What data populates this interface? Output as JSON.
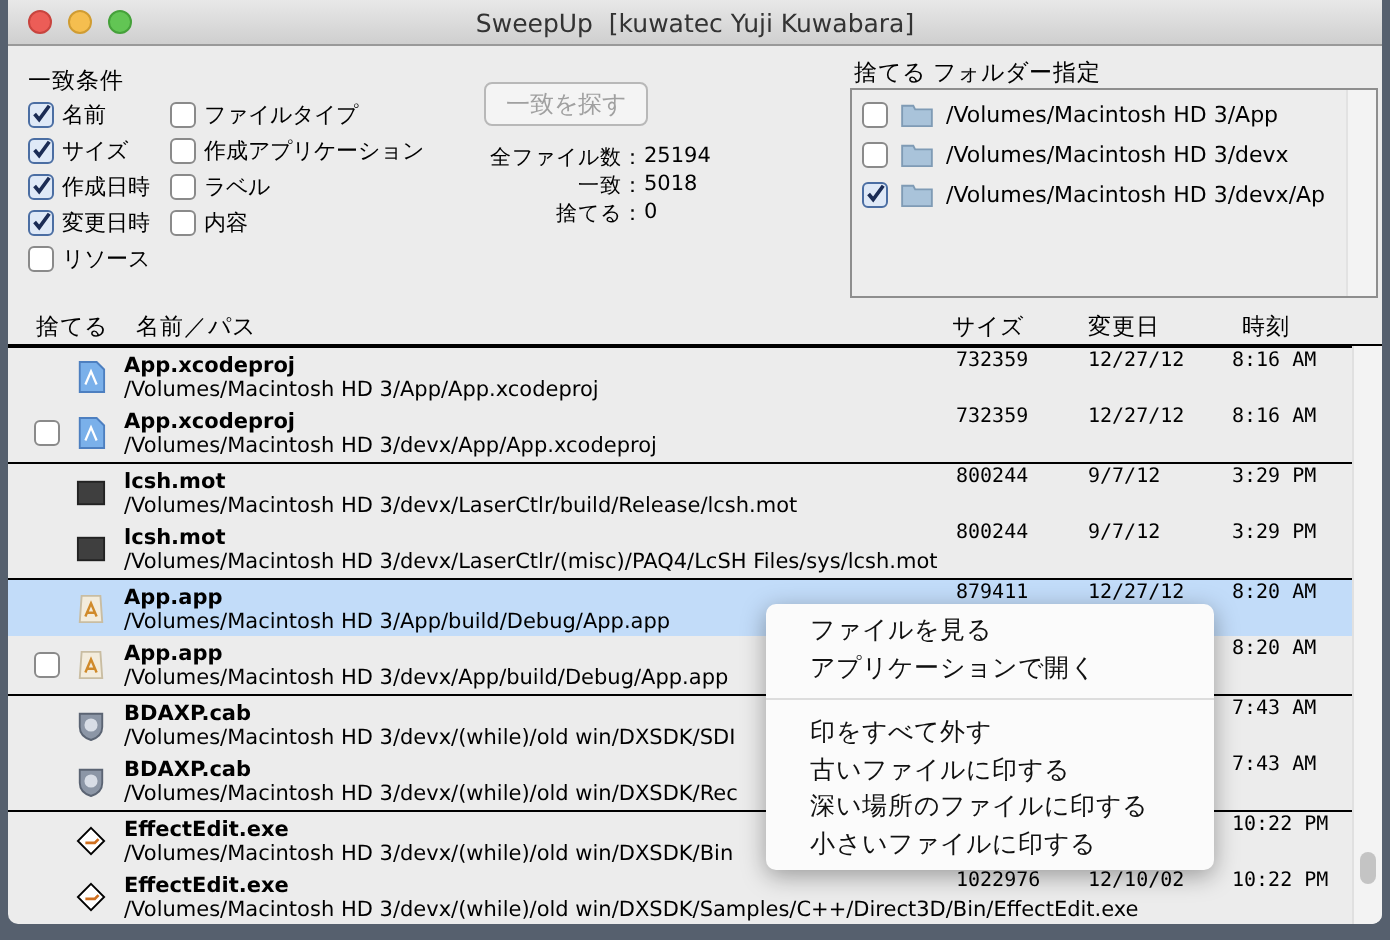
{
  "window": {
    "title": "SweepUp  [kuwatec Yuji Kuwabara]"
  },
  "conditions": {
    "title": "一致条件",
    "items": [
      {
        "label": "名前",
        "checked": true
      },
      {
        "label": "サイズ",
        "checked": true
      },
      {
        "label": "作成日時",
        "checked": true
      },
      {
        "label": "変更日時",
        "checked": true
      },
      {
        "label": "リソース",
        "checked": false
      },
      {
        "label": "ファイルタイプ",
        "checked": false
      },
      {
        "label": "作成アプリケーション",
        "checked": false
      },
      {
        "label": "ラベル",
        "checked": false
      },
      {
        "label": "内容",
        "checked": false
      }
    ]
  },
  "find_button": {
    "label": "一致を探す",
    "disabled": true
  },
  "stats": [
    {
      "label": "全ファイル数：",
      "value": "25194"
    },
    {
      "label": "一致：",
      "value": "5018"
    },
    {
      "label": "捨てる：",
      "value": "0"
    }
  ],
  "folders": {
    "title": "捨てる フォルダー指定",
    "items": [
      {
        "path": "/Volumes/Macintosh HD 3/App",
        "checked": false
      },
      {
        "path": "/Volumes/Macintosh HD 3/devx",
        "checked": false
      },
      {
        "path": "/Volumes/Macintosh HD 3/devx/Ap",
        "checked": true
      }
    ]
  },
  "table": {
    "columns": [
      "捨てる",
      "名前／パス",
      "サイズ",
      "変更日",
      "時刻"
    ],
    "groups": [
      {
        "rows": [
          {
            "kind": "xcode",
            "name": "App.xcodeproj",
            "path": "/Volumes/Macintosh HD 3/App/App.xcodeproj",
            "size": "732359",
            "date": "12/27/12",
            "time": "8:16 AM",
            "selected": false
          },
          {
            "kind": "xcode",
            "name": "App.xcodeproj",
            "path": "/Volumes/Macintosh HD 3/devx/App/App.xcodeproj",
            "size": "732359",
            "date": "12/27/12",
            "time": "8:16 AM",
            "checked": false,
            "selected": false
          }
        ]
      },
      {
        "rows": [
          {
            "kind": "binary",
            "name": "lcsh.mot",
            "path": "/Volumes/Macintosh HD 3/devx/LaserCtlr/build/Release/lcsh.mot",
            "size": "800244",
            "date": "9/7/12",
            "time": "3:29 PM",
            "selected": false
          },
          {
            "kind": "binary",
            "name": "lcsh.mot",
            "path": "/Volumes/Macintosh HD 3/devx/LaserCtlr/(misc)/PAQ4/LcSH Files/sys/lcsh.mot",
            "size": "800244",
            "date": "9/7/12",
            "time": "3:29 PM",
            "selected": false
          }
        ]
      },
      {
        "rows": [
          {
            "kind": "app",
            "name": "App.app",
            "path": "/Volumes/Macintosh HD 3/App/build/Debug/App.app",
            "size": "879411",
            "date": "12/27/12",
            "time": "8:20 AM",
            "selected": true
          },
          {
            "kind": "app",
            "name": "App.app",
            "path": "/Volumes/Macintosh HD 3/devx/App/build/Debug/App.app",
            "time": "8:20 AM",
            "checked": false,
            "selected": false
          }
        ]
      },
      {
        "rows": [
          {
            "kind": "cab",
            "name": "BDAXP.cab",
            "path": "/Volumes/Macintosh HD 3/devx/(while)/old win/DXSDK/SDI",
            "time": "7:43 AM",
            "selected": false
          },
          {
            "kind": "cab",
            "name": "BDAXP.cab",
            "path": "/Volumes/Macintosh HD 3/devx/(while)/old win/DXSDK/Rec",
            "time": "7:43 AM",
            "selected": false
          }
        ]
      },
      {
        "rows": [
          {
            "kind": "exe",
            "name": "EffectEdit.exe",
            "path": "/Volumes/Macintosh HD 3/devx/(while)/old win/DXSDK/Bin",
            "time": "10:22 PM",
            "selected": false
          },
          {
            "kind": "exe",
            "name": "EffectEdit.exe",
            "path": "/Volumes/Macintosh HD 3/devx/(while)/old win/DXSDK/Samples/C++/Direct3D/Bin/EffectEdit.exe",
            "size": "1022976",
            "date": "12/10/02",
            "time": "10:22 PM",
            "selected": false
          }
        ]
      }
    ]
  },
  "context_menu": {
    "groups": [
      [
        "ファイルを見る",
        "アプリケーションで開く"
      ],
      [
        "印をすべて外す",
        "古いファイルに印する",
        "深い場所のファイルに印する",
        "小さいファイルに印する"
      ]
    ]
  }
}
